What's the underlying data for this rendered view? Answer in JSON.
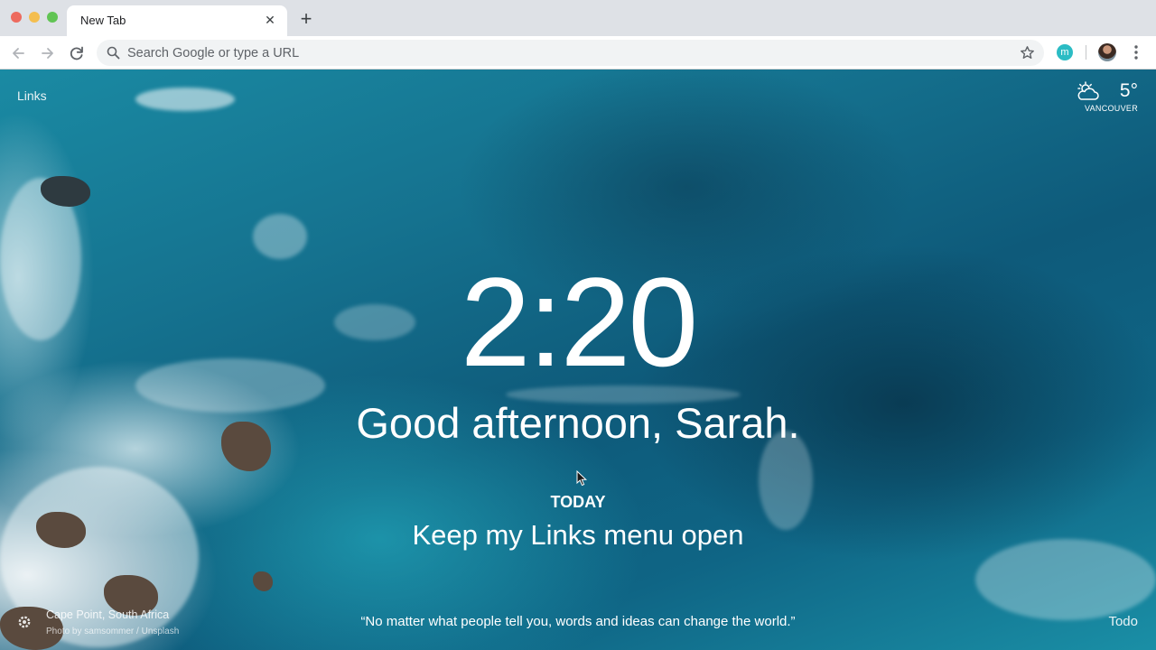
{
  "browser": {
    "tab_title": "New Tab",
    "tab_close_icon": "close-icon",
    "new_tab_icon": "plus-icon",
    "omnibox_placeholder": "Search Google or type a URL",
    "extension_letter": "m"
  },
  "dashboard": {
    "links_label": "Links",
    "weather": {
      "temperature": "5°",
      "location": "VANCOUVER",
      "icon": "partly-cloudy-icon"
    },
    "time": "2:20",
    "greeting": "Good afternoon, Sarah.",
    "focus_label": "TODAY",
    "focus_text": "Keep my Links menu open",
    "photo_location": "Cape Point, South Africa",
    "photo_credit": "Photo by samsommer / Unsplash",
    "quote": "“No matter what people tell you, words and ideas can change the world.”",
    "todo_label": "Todo"
  },
  "colors": {
    "tabstrip": "#dee1e6",
    "omnibox": "#f1f3f4",
    "extension": "#2bbcc4",
    "ocean": "#0e5a7a"
  }
}
